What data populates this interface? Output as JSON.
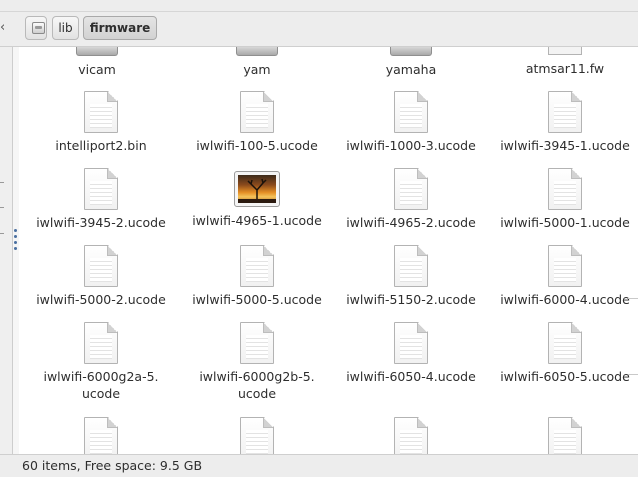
{
  "toolbar": {
    "crumbs": [
      {
        "label": ""
      },
      {
        "label": "lib"
      },
      {
        "label": "firmware"
      }
    ]
  },
  "icons": {
    "back": "chevron-left-icon",
    "root": "drive-icon",
    "file": "text-file-icon",
    "image": "image-file-icon",
    "folder": "folder-icon"
  },
  "files": {
    "row0": [
      "vicam",
      "yam",
      "yamaha",
      "atmsar11.fw"
    ],
    "row1": [
      "intelliport2.bin",
      "iwlwifi-100-5.ucode",
      "iwlwifi-1000-3.ucode",
      "iwlwifi-3945-1.ucode"
    ],
    "row2": [
      "iwlwifi-3945-2.ucode",
      "iwlwifi-4965-1.ucode",
      "iwlwifi-4965-2.ucode",
      "iwlwifi-5000-1.ucode"
    ],
    "row3": [
      "iwlwifi-5000-2.ucode",
      "iwlwifi-5000-5.ucode",
      "iwlwifi-5150-2.ucode",
      "iwlwifi-6000-4.ucode"
    ],
    "row4": [
      "iwlwifi-6000g2a-5.\nucode",
      "iwlwifi-6000g2b-5.\nucode",
      "iwlwifi-6050-4.ucode",
      "iwlwifi-6050-5.ucode"
    ]
  },
  "status": {
    "text": "60 items, Free space: 9.5 GB"
  }
}
